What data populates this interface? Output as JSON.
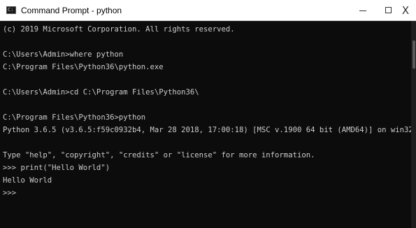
{
  "window": {
    "title": "Command Prompt - python",
    "icon": "command-prompt-icon",
    "controls": {
      "minimize": "minimize-icon",
      "maximize": "maximize-icon",
      "close_glyph": "X"
    }
  },
  "console": {
    "lines": [
      "(c) 2019 Microsoft Corporation. All rights reserved.",
      "",
      "C:\\Users\\Admin>where python",
      "C:\\Program Files\\Python36\\python.exe",
      "",
      "C:\\Users\\Admin>cd C:\\Program Files\\Python36\\",
      "",
      "C:\\Program Files\\Python36>python",
      "Python 3.6.5 (v3.6.5:f59c0932b4, Mar 28 2018, 17:00:18) [MSC v.1900 64 bit (AMD64)] on win32",
      "",
      "Type \"help\", \"copyright\", \"credits\" or \"license\" for more information.",
      ">>> print(\"Hello World\")",
      "Hello World",
      ">>>"
    ]
  },
  "colors": {
    "console_background": "#0c0c0c",
    "console_text": "#cccccc",
    "titlebar_background": "#ffffff"
  }
}
